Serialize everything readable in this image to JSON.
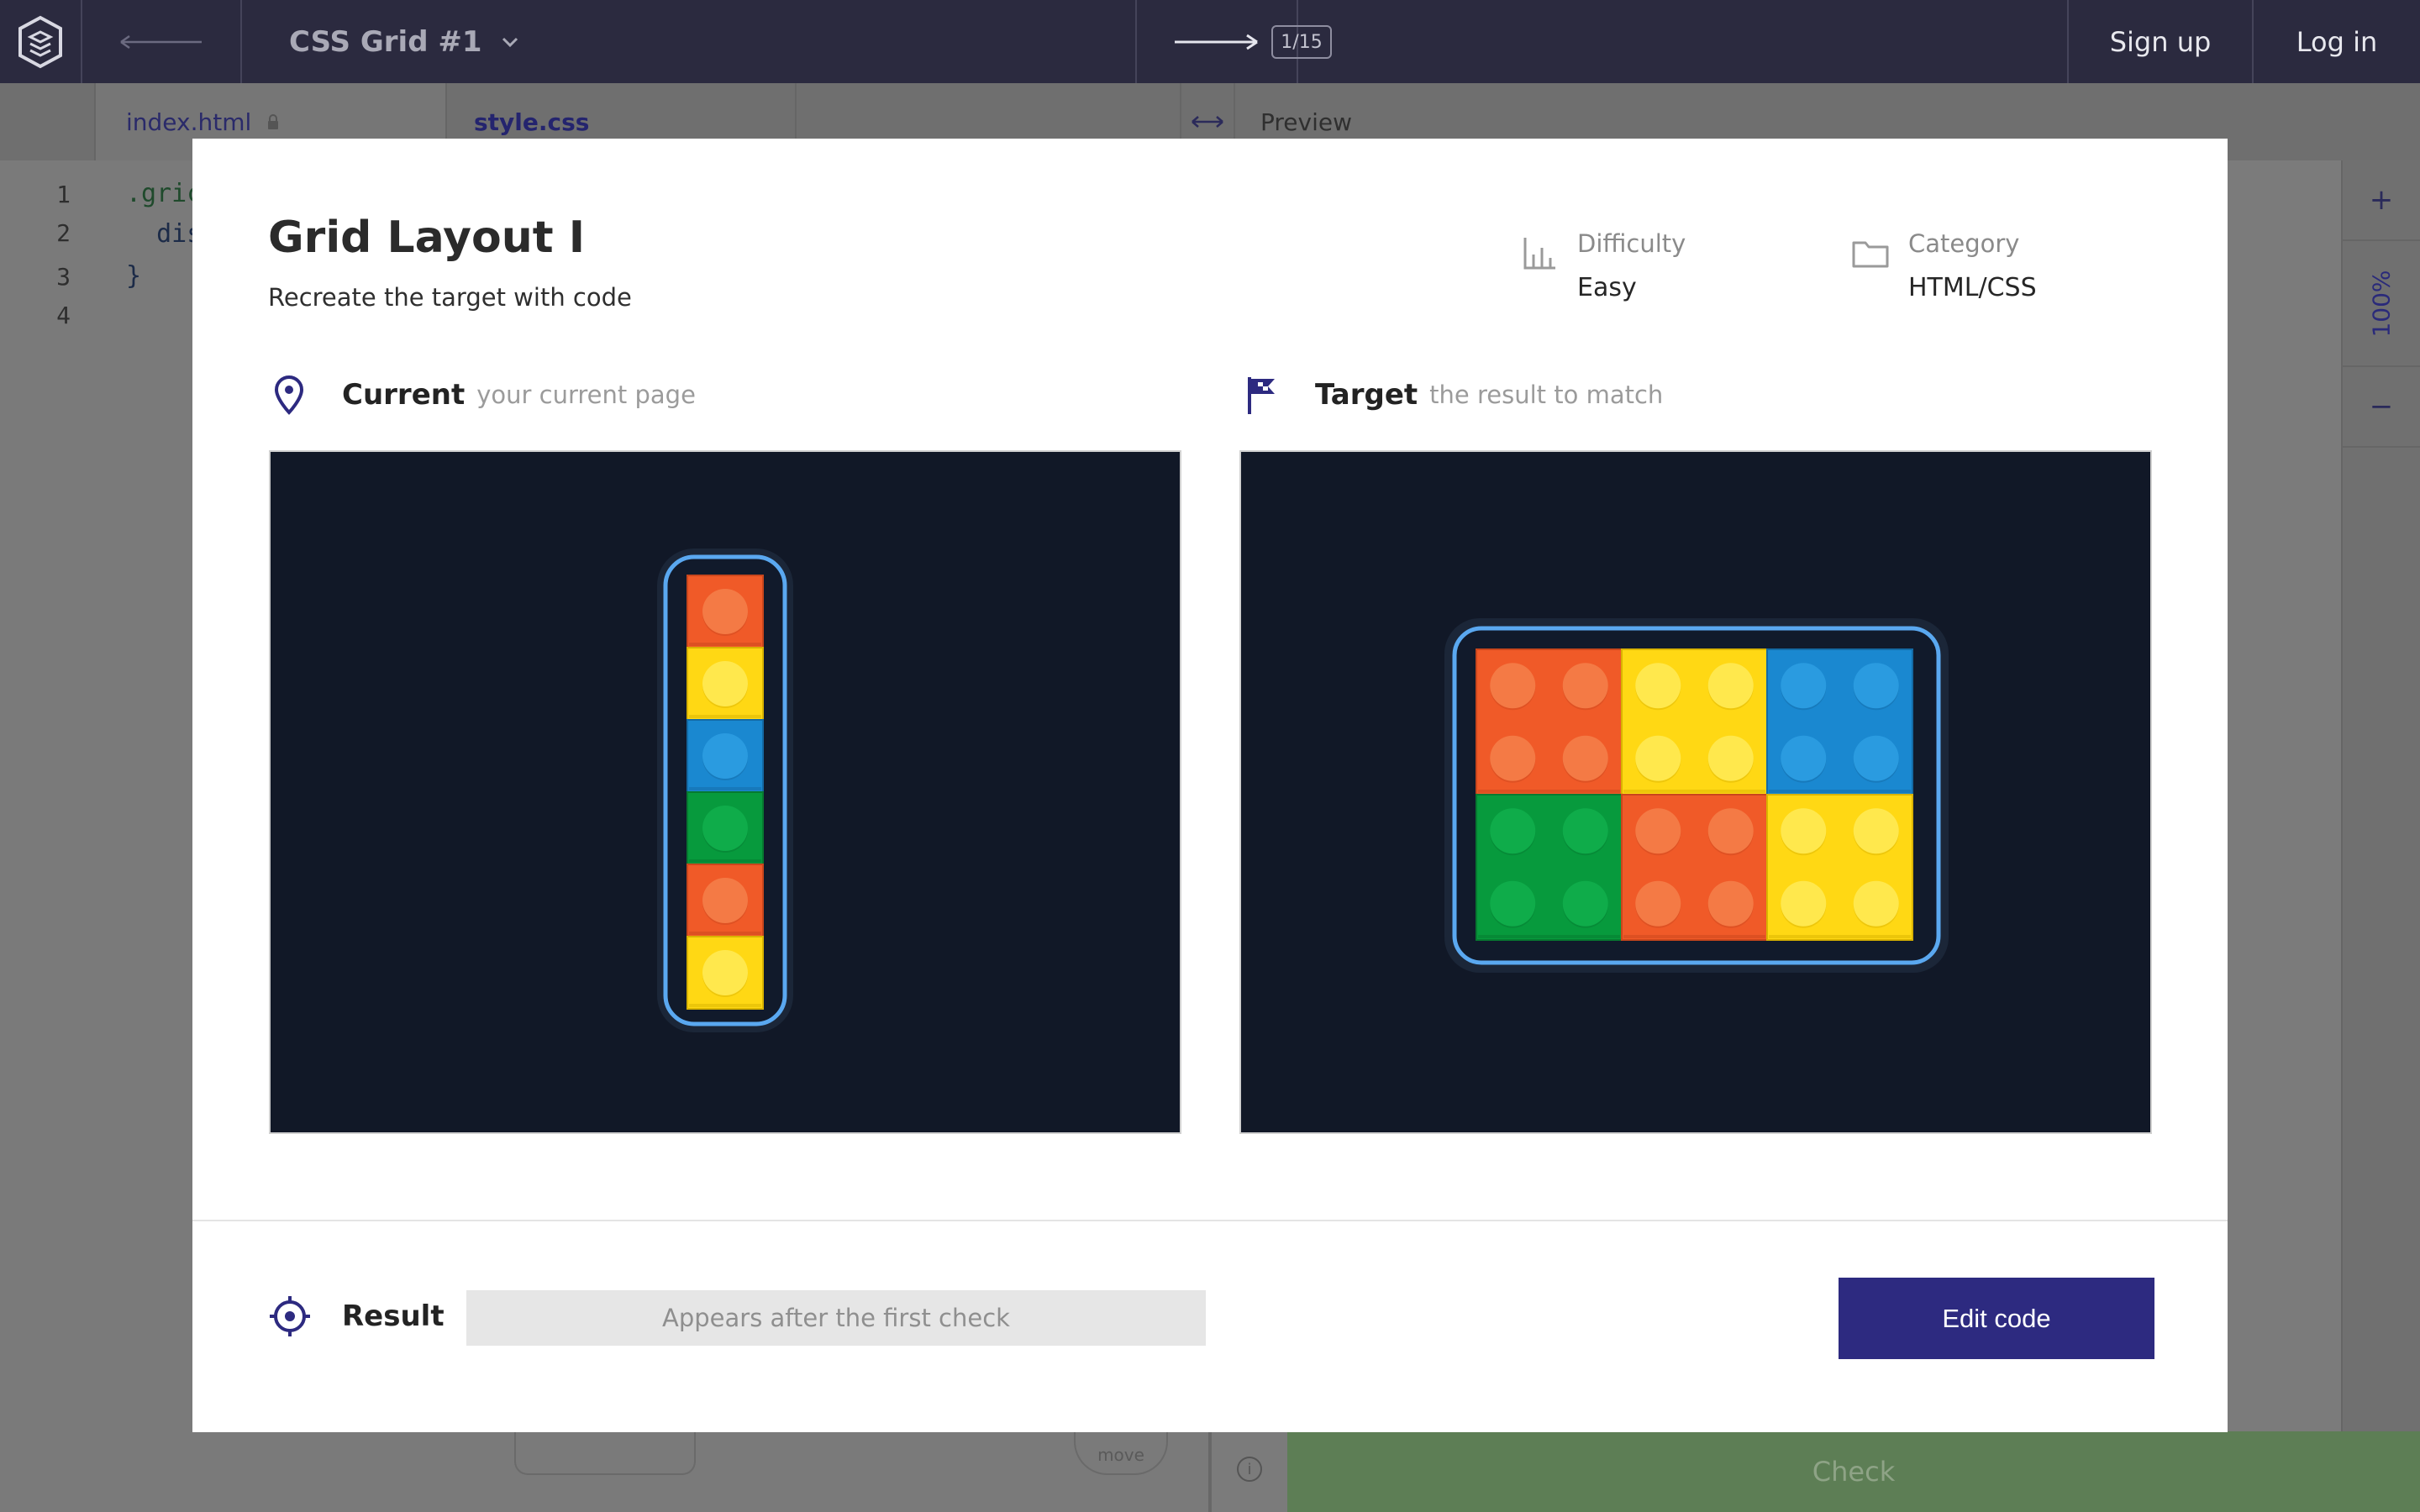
{
  "topbar": {
    "title": "CSS Grid #1",
    "counter": "1/15",
    "signup": "Sign up",
    "login": "Log in"
  },
  "tabs": {
    "index": "index.html",
    "style": "style.css",
    "preview": "Preview"
  },
  "editor": {
    "line_numbers": [
      "1",
      "2",
      "3",
      "4"
    ],
    "lines": [
      ".gric",
      "  dis",
      "}",
      ""
    ]
  },
  "zoom": {
    "plus": "+",
    "level": "100%",
    "minus": "−"
  },
  "background": {
    "check_label": "Check",
    "move_label": "move",
    "info": "i"
  },
  "modal": {
    "title": "Grid Layout I",
    "subtitle": "Recreate the target with code",
    "difficulty_label": "Difficulty",
    "difficulty_value": "Easy",
    "category_label": "Category",
    "category_value": "HTML/CSS",
    "current_title": "Current",
    "current_sub": "your current page",
    "target_title": "Target",
    "target_sub": "the result to match",
    "result_label": "Result",
    "result_placeholder": "Appears after the first check",
    "edit_button": "Edit code"
  },
  "colors": {
    "accent": "#2d2a80",
    "topbar": "#2b2a3f",
    "brick_orange": "#f05a28",
    "brick_yellow": "#ffd814",
    "brick_blue": "#1a88d0",
    "brick_green": "#079a3d",
    "frame_bg": "#111827",
    "outline_blue": "#5aa8f0"
  },
  "current_bricks": [
    "orange",
    "yellow",
    "blue",
    "green",
    "orange",
    "yellow"
  ],
  "target_bricks": [
    "orange",
    "yellow",
    "blue",
    "green",
    "orange",
    "yellow"
  ]
}
